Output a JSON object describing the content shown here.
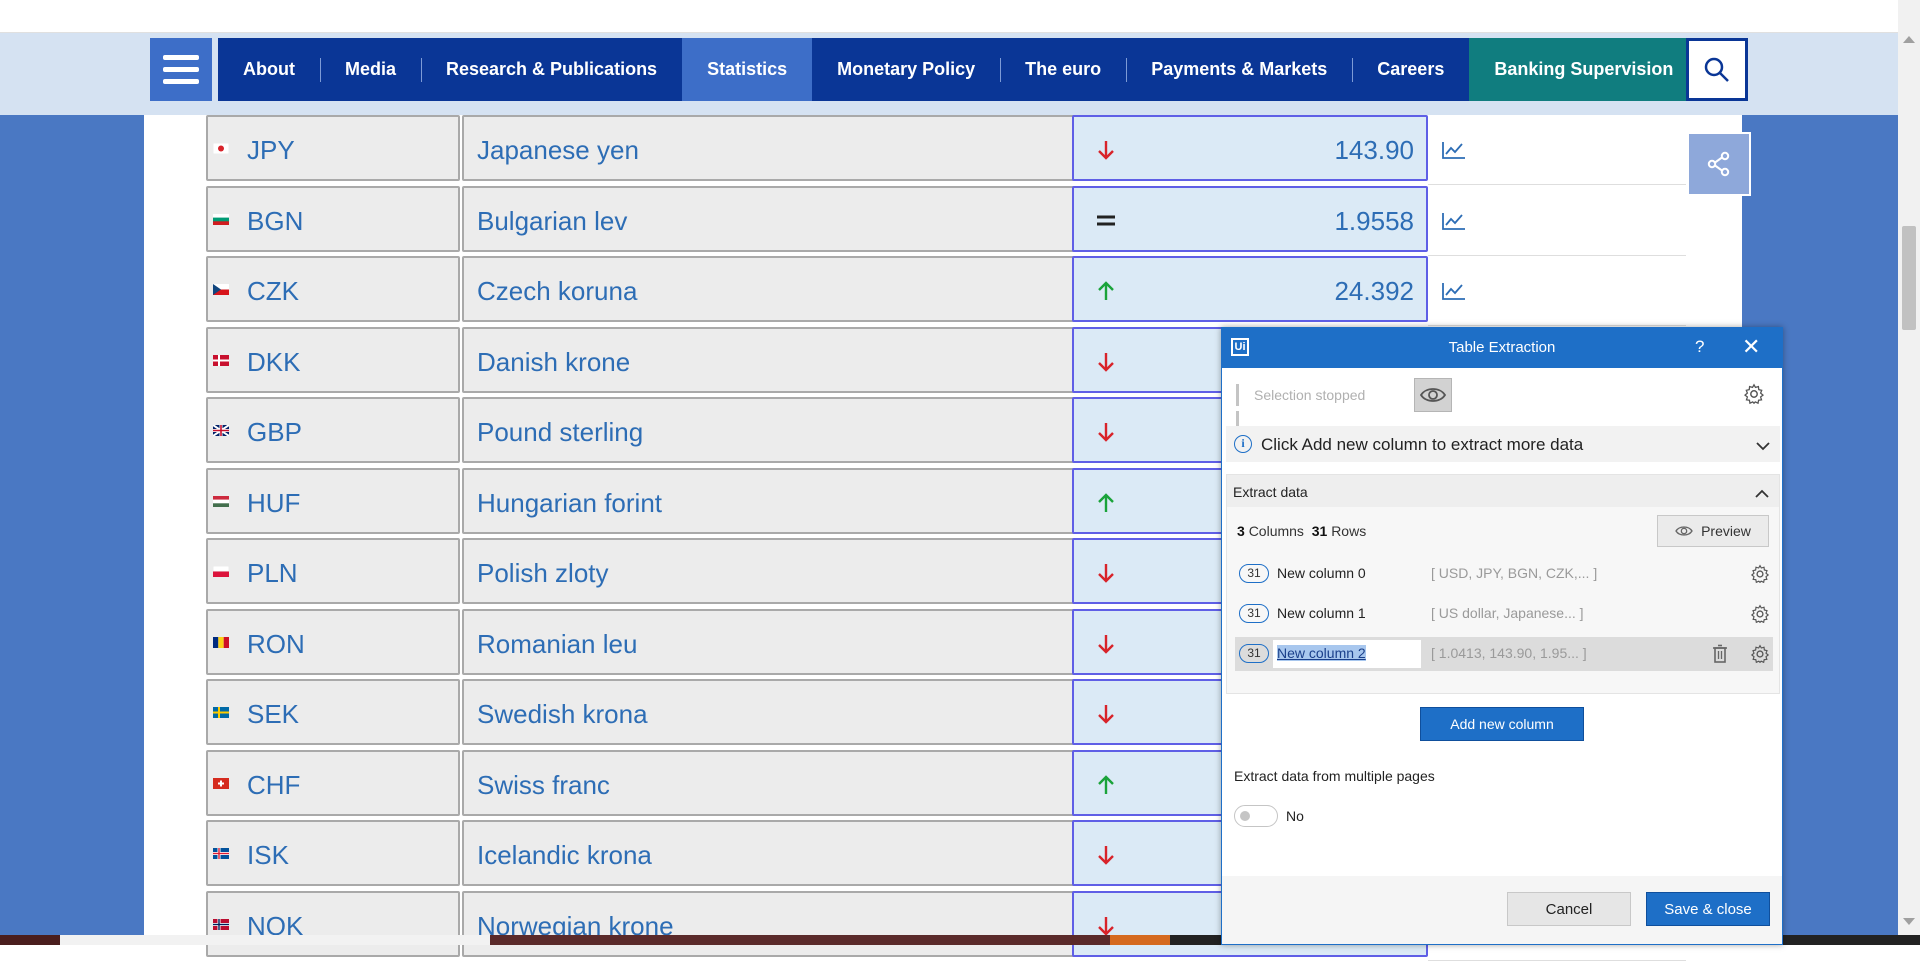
{
  "nav": {
    "items": [
      {
        "label": "About"
      },
      {
        "label": "Media"
      },
      {
        "label": "Research & Publications"
      },
      {
        "label": "Statistics",
        "active": true
      },
      {
        "label": "Monetary Policy"
      },
      {
        "label": "The euro"
      },
      {
        "label": "Payments & Markets"
      },
      {
        "label": "Careers"
      },
      {
        "label": "Banking Supervision"
      }
    ],
    "icons": {
      "menu": "hamburger-icon",
      "search": "search-icon",
      "share": "share-icon"
    }
  },
  "rates": [
    {
      "code": "JPY",
      "name": "Japanese yen",
      "trend": "down",
      "value": "143.90"
    },
    {
      "code": "BGN",
      "name": "Bulgarian lev",
      "trend": "equal",
      "value": "1.9558"
    },
    {
      "code": "CZK",
      "name": "Czech koruna",
      "trend": "up",
      "value": "24.392"
    },
    {
      "code": "DKK",
      "name": "Danish krone",
      "trend": "down",
      "value": ""
    },
    {
      "code": "GBP",
      "name": "Pound sterling",
      "trend": "down",
      "value": ""
    },
    {
      "code": "HUF",
      "name": "Hungarian forint",
      "trend": "up",
      "value": ""
    },
    {
      "code": "PLN",
      "name": "Polish zloty",
      "trend": "down",
      "value": ""
    },
    {
      "code": "RON",
      "name": "Romanian leu",
      "trend": "down",
      "value": ""
    },
    {
      "code": "SEK",
      "name": "Swedish krona",
      "trend": "down",
      "value": ""
    },
    {
      "code": "CHF",
      "name": "Swiss franc",
      "trend": "up",
      "value": ""
    },
    {
      "code": "ISK",
      "name": "Icelandic krona",
      "trend": "down",
      "value": ""
    },
    {
      "code": "NOK",
      "name": "Norwegian krone",
      "trend": "down",
      "value": ""
    }
  ],
  "colors": {
    "nav_bg": "#0a3696",
    "nav_active": "#3d6ec8",
    "banking_bg": "#107d7f",
    "link_text": "#2d6db5",
    "trend_down": "#d8232a",
    "trend_up": "#1aa33a",
    "dialog_accent": "#1e6fc7"
  },
  "dialog": {
    "logo": "Ui",
    "title": "Table Extraction",
    "help": "?",
    "close": "✕",
    "selection_status": "Selection stopped",
    "info_text": "Click Add new column to extract more data",
    "extract_title": "Extract data",
    "columns_count": "3",
    "columns_label": "Columns",
    "rows_count": "31",
    "rows_label": "Rows",
    "preview_label": "Preview",
    "columns": [
      {
        "count": "31",
        "name": "New column 0",
        "preview": "[ USD, JPY, BGN, CZK,... ]"
      },
      {
        "count": "31",
        "name": "New column 1",
        "preview": "[ US dollar, Japanese... ]"
      },
      {
        "count": "31",
        "name": "New column 2",
        "preview": "[ 1.0413, 143.90, 1.95... ]",
        "editing": true
      }
    ],
    "add_column_label": "Add new column",
    "multi_page_label": "Extract data from multiple pages",
    "multi_page_value": "No",
    "cancel_label": "Cancel",
    "save_label": "Save & close"
  }
}
